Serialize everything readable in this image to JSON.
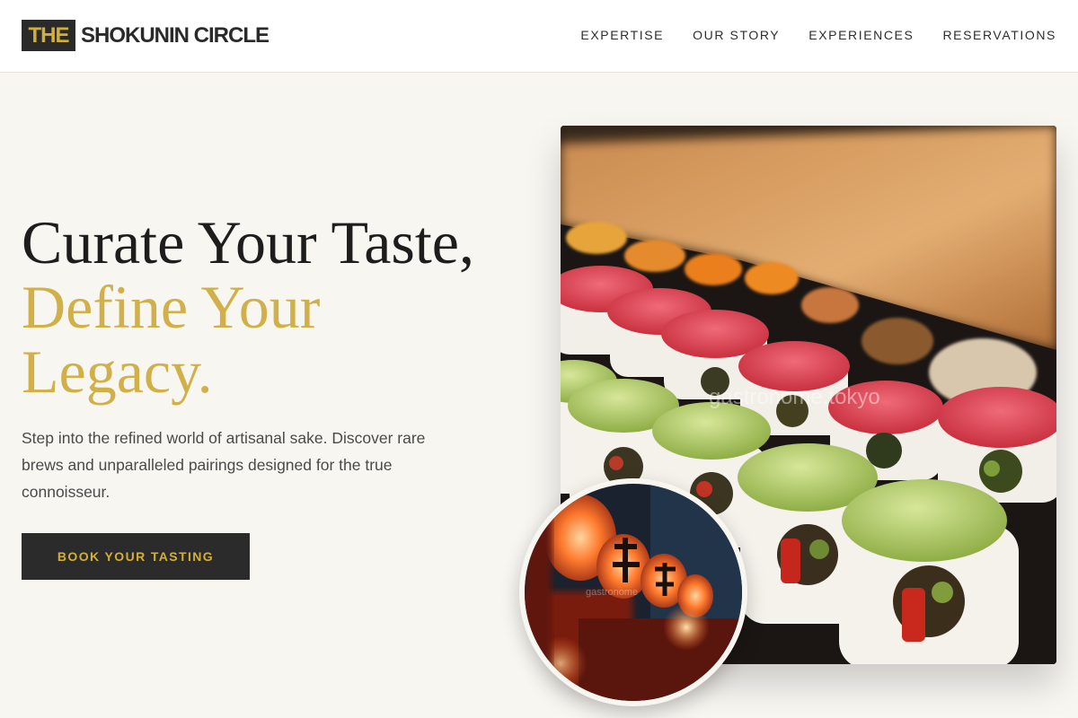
{
  "header": {
    "logo_the": "THE",
    "logo_name": "SHOKUNIN CIRCLE",
    "nav": [
      "EXPERTISE",
      "OUR STORY",
      "EXPERIENCES",
      "RESERVATIONS"
    ]
  },
  "hero": {
    "headline_line1": "Curate Your Taste,",
    "headline_accent": "Define Your Legacy.",
    "subtext": "Step into the refined world of artisanal sake. Discover rare brews and unparalleled pairings designed for the true connoisseur.",
    "cta_label": "BOOK YOUR TASTING"
  },
  "images": {
    "main_watermark": "gastronome.tokyo",
    "inset_watermark": "gastronome"
  },
  "colors": {
    "accent_gold": "#d4af37",
    "dark": "#2b2b2b",
    "page_bg": "#f8f6f1"
  }
}
